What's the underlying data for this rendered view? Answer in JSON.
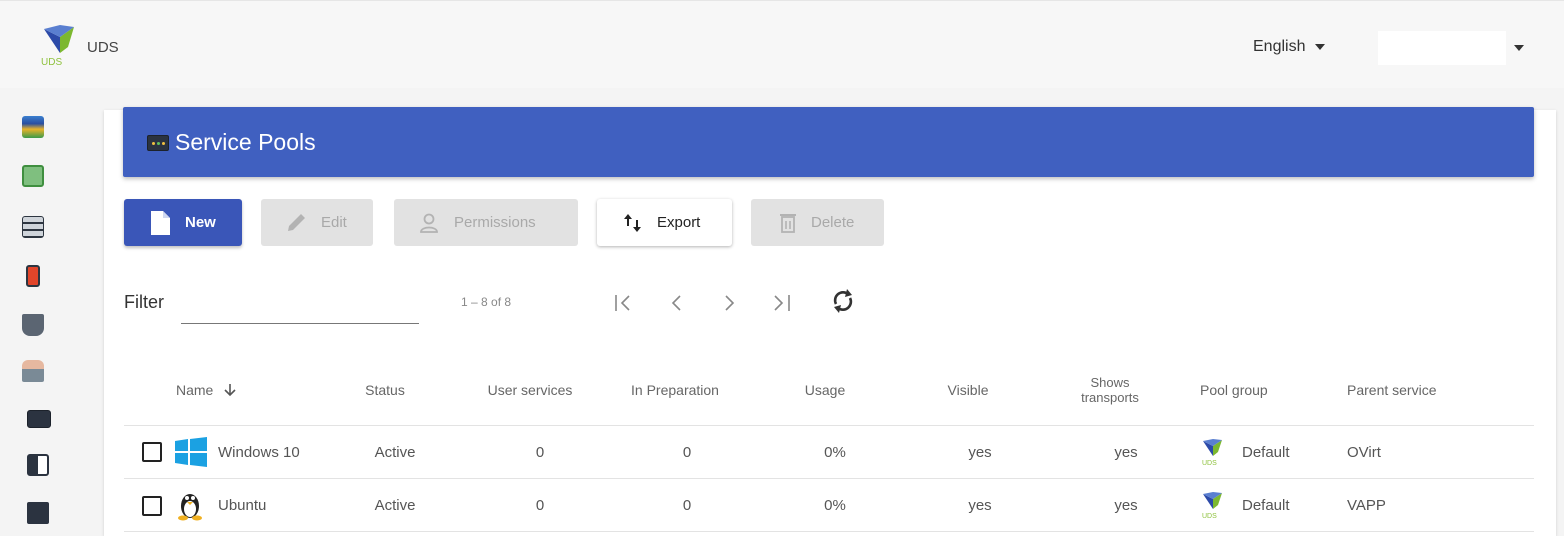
{
  "app": {
    "title": "UDS"
  },
  "header": {
    "language": "English"
  },
  "page": {
    "title": "Service Pools"
  },
  "toolbar": {
    "new_label": "New",
    "edit_label": "Edit",
    "permissions_label": "Permissions",
    "export_label": "Export",
    "delete_label": "Delete"
  },
  "filter": {
    "label": "Filter",
    "value": ""
  },
  "pagination": {
    "range": "1 – 8 of 8"
  },
  "table": {
    "columns": {
      "name": "Name",
      "status": "Status",
      "user_services": "User services",
      "in_preparation": "In Preparation",
      "usage": "Usage",
      "visible": "Visible",
      "shows_transports_1": "Shows",
      "shows_transports_2": "transports",
      "pool_group": "Pool group",
      "parent_service": "Parent service"
    },
    "rows": [
      {
        "name": "Windows 10",
        "status": "Active",
        "user_services": "0",
        "in_preparation": "0",
        "usage": "0%",
        "visible": "yes",
        "shows_transports": "yes",
        "pool_group": "Default",
        "parent_service": "OVirt",
        "os_icon": "windows-icon"
      },
      {
        "name": "Ubuntu",
        "status": "Active",
        "user_services": "0",
        "in_preparation": "0",
        "usage": "0%",
        "visible": "yes",
        "shows_transports": "yes",
        "pool_group": "Default",
        "parent_service": "VAPP",
        "os_icon": "linux-tux-icon"
      }
    ]
  },
  "colors": {
    "header_blue": "#4060c0",
    "primary_button": "#3a56b8",
    "disabled_button": "#e2e2e2",
    "windows_blue": "#1ba1e2"
  }
}
